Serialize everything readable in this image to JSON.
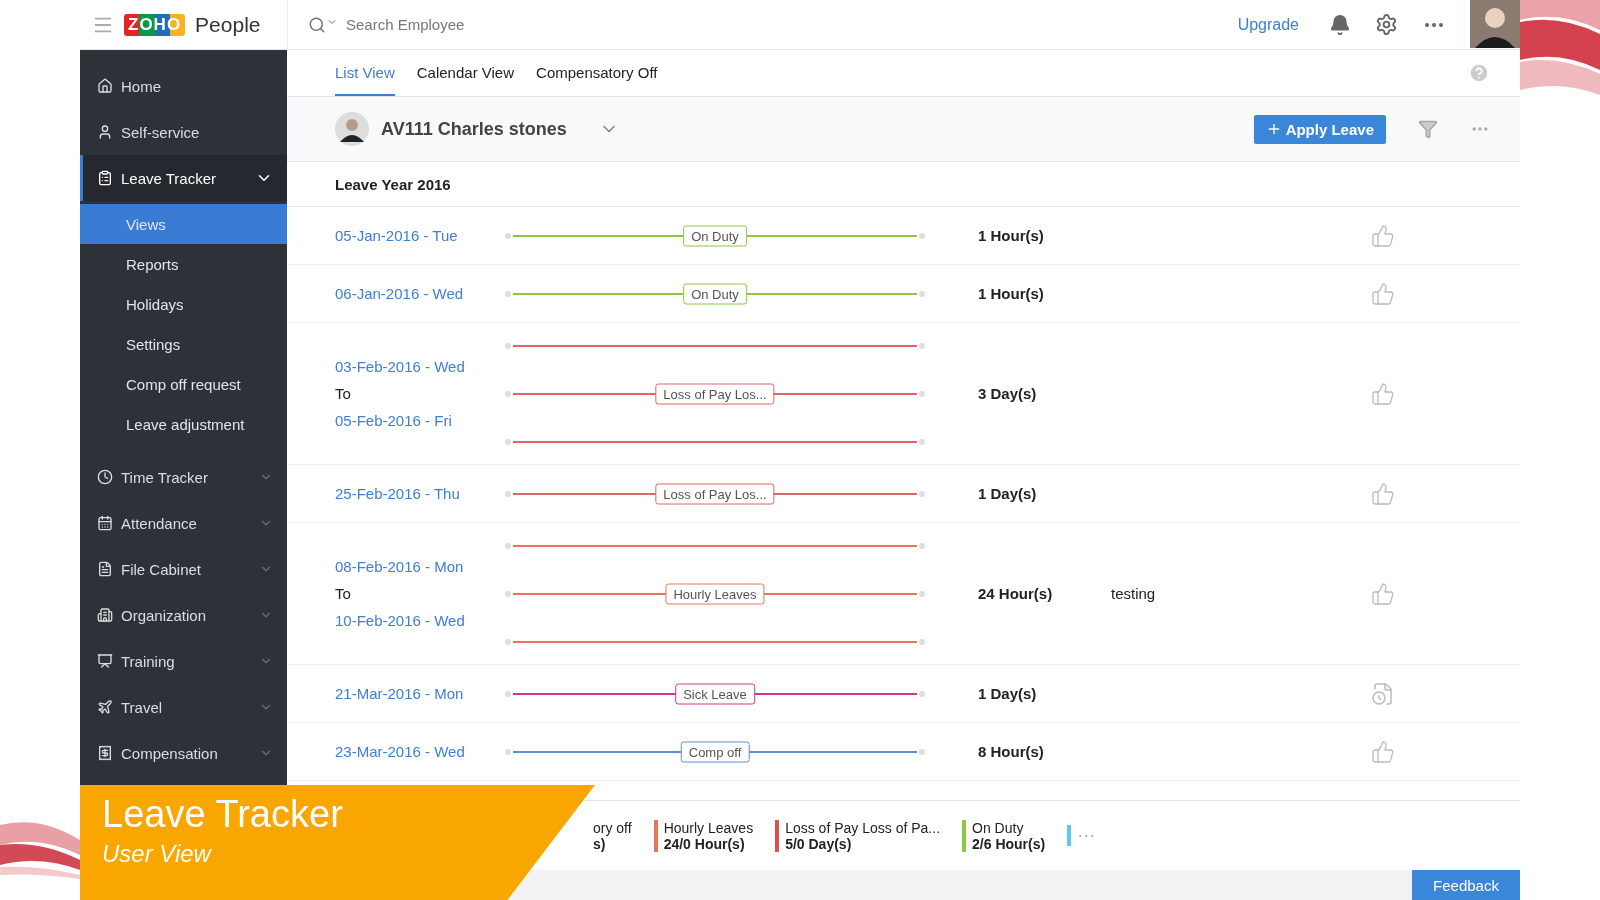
{
  "topbar": {
    "logo_mark": "ZOHO",
    "product": "People",
    "search": {
      "placeholder": "Search Employee"
    },
    "upgrade": "Upgrade"
  },
  "sidebar": {
    "items": [
      {
        "label": "Home",
        "kind": "link",
        "selected": false
      },
      {
        "label": "Self-service",
        "kind": "link",
        "selected": false
      },
      {
        "label": "Leave Tracker",
        "kind": "menu",
        "selected": true,
        "expanded": true,
        "children": [
          {
            "label": "Views",
            "selected": true
          },
          {
            "label": "Reports",
            "selected": false
          },
          {
            "label": "Holidays",
            "selected": false
          },
          {
            "label": "Settings",
            "selected": false
          },
          {
            "label": "Comp off request",
            "selected": false
          },
          {
            "label": "Leave adjustment",
            "selected": false
          }
        ]
      },
      {
        "label": "Time Tracker",
        "kind": "menu",
        "selected": false,
        "expanded": false
      },
      {
        "label": "Attendance",
        "kind": "menu",
        "selected": false,
        "expanded": false
      },
      {
        "label": "File Cabinet",
        "kind": "menu",
        "selected": false,
        "expanded": false
      },
      {
        "label": "Organization",
        "kind": "menu",
        "selected": false,
        "expanded": false
      },
      {
        "label": "Training",
        "kind": "menu",
        "selected": false,
        "expanded": false
      },
      {
        "label": "Travel",
        "kind": "menu",
        "selected": false,
        "expanded": false
      },
      {
        "label": "Compensation",
        "kind": "menu",
        "selected": false,
        "expanded": false
      }
    ]
  },
  "tabs": [
    {
      "label": "List View",
      "selected": true
    },
    {
      "label": "Calendar View",
      "selected": false
    },
    {
      "label": "Compensatory Off",
      "selected": false
    }
  ],
  "employee": {
    "name": "AV111 Charles stones",
    "apply_button": "Apply Leave"
  },
  "leave_year": "Leave Year 2016",
  "rows": [
    {
      "start": "05-Jan-2016 - Tue",
      "type": "On Duty",
      "color": "#8dc63f",
      "duration": "1 Hour(s)",
      "kind": "approved"
    },
    {
      "start": "06-Jan-2016 - Wed",
      "type": "On Duty",
      "color": "#8dc63f",
      "duration": "1 Hour(s)",
      "kind": "approved"
    },
    {
      "start": "03-Feb-2016 - Wed",
      "separator": "To",
      "end": "05-Feb-2016 - Fri",
      "type": "Loss of Pay Los...",
      "color": "#e06666",
      "duration": "3 Day(s)",
      "kind": "approved"
    },
    {
      "start": "25-Feb-2016 - Thu",
      "type": "Loss of Pay Los...",
      "color": "#e06666",
      "duration": "1 Day(s)",
      "kind": "approved"
    },
    {
      "start": "08-Feb-2016 - Mon",
      "separator": "To",
      "end": "10-Feb-2016 - Wed",
      "type": "Hourly Leaves",
      "color": "#e8775a",
      "duration": "24 Hour(s)",
      "reason": "testing",
      "kind": "approved"
    },
    {
      "start": "21-Mar-2016 - Mon",
      "type": "Sick Leave",
      "color": "#d6338a",
      "duration": "1 Day(s)",
      "kind": "pending"
    },
    {
      "start": "23-Mar-2016 - Wed",
      "type": "Comp off",
      "color": "#5b8fd6",
      "duration": "8 Hour(s)",
      "kind": "approved"
    }
  ],
  "summary": [
    {
      "kind": "balance",
      "label": "ory off",
      "value": "s)"
    },
    {
      "kind": "balance",
      "label": "Hourly Leaves",
      "value": "24/0 Hour(s)",
      "color": "#e8775a"
    },
    {
      "kind": "balance",
      "label": "Loss of Pay Loss of Pa...",
      "value": "5/0 Day(s)",
      "color": "#d9534f"
    },
    {
      "kind": "balance",
      "label": "On Duty",
      "value": "2/6 Hour(s)",
      "color": "#8dc63f"
    },
    {
      "kind": "more",
      "label": "···",
      "color": "#5bc8f0"
    }
  ],
  "feedback": "Feedback",
  "banner": {
    "title": "Leave Tracker",
    "subtitle": "User View"
  }
}
